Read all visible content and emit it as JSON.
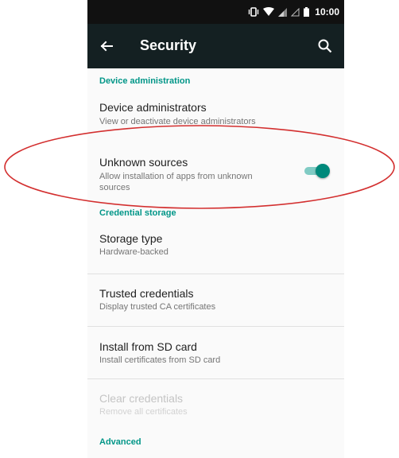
{
  "status_bar": {
    "time": "10:00",
    "icons": [
      "vibrate-icon",
      "wifi-icon",
      "signal-icon",
      "signal-icon",
      "battery-icon"
    ]
  },
  "toolbar": {
    "title": "Security",
    "back_icon": "arrow-back-icon",
    "search_icon": "search-icon"
  },
  "sections": {
    "device_administration": "Device administration",
    "credential_storage": "Credential storage",
    "advanced": "Advanced"
  },
  "items": {
    "device_administrators": {
      "title": "Device administrators",
      "subtitle": "View or deactivate device administrators"
    },
    "unknown_sources": {
      "title": "Unknown sources",
      "subtitle_line1": "Allow installation of apps from unknown",
      "subtitle_line2": "sources",
      "toggle_on": true
    },
    "storage_type": {
      "title": "Storage type",
      "subtitle": "Hardware-backed"
    },
    "trusted_credentials": {
      "title": "Trusted credentials",
      "subtitle": "Display trusted CA certificates"
    },
    "install_from_sd": {
      "title": "Install from SD card",
      "subtitle": "Install certificates from SD card"
    },
    "clear_credentials": {
      "title": "Clear credentials",
      "subtitle": "Remove all certificates",
      "disabled": true
    }
  },
  "colors": {
    "accent": "#009688",
    "toolbar": "#142022",
    "status_bar": "#111111",
    "annotation": "#d32f2f"
  }
}
